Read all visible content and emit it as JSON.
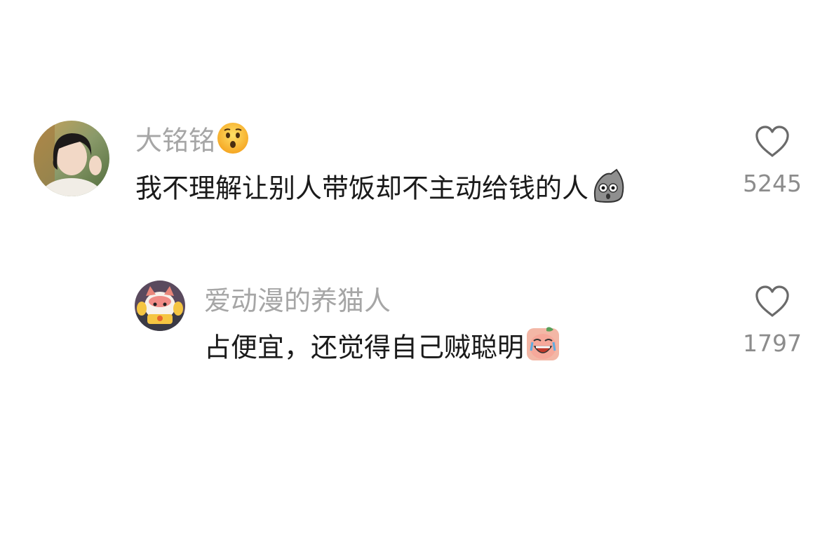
{
  "comments": [
    {
      "username": "大铭铭",
      "username_emoji": "hushed-face-emoji",
      "text": "我不理解让别人带饭却不主动给钱的人",
      "text_emoji": "shocked-bag-sticker",
      "likes": "5245",
      "liked": false
    }
  ],
  "replies": [
    {
      "username": "爱动漫的养猫人",
      "text": "占便宜，还觉得自己贼聪明",
      "text_emoji": "laughing-crying-peach-sticker",
      "likes": "1797",
      "liked": false
    }
  ],
  "colors": {
    "username": "#a6a6a6",
    "text": "#1a1a1a",
    "count": "#8c8c8c",
    "heart_outline": "#6a6a6a"
  }
}
